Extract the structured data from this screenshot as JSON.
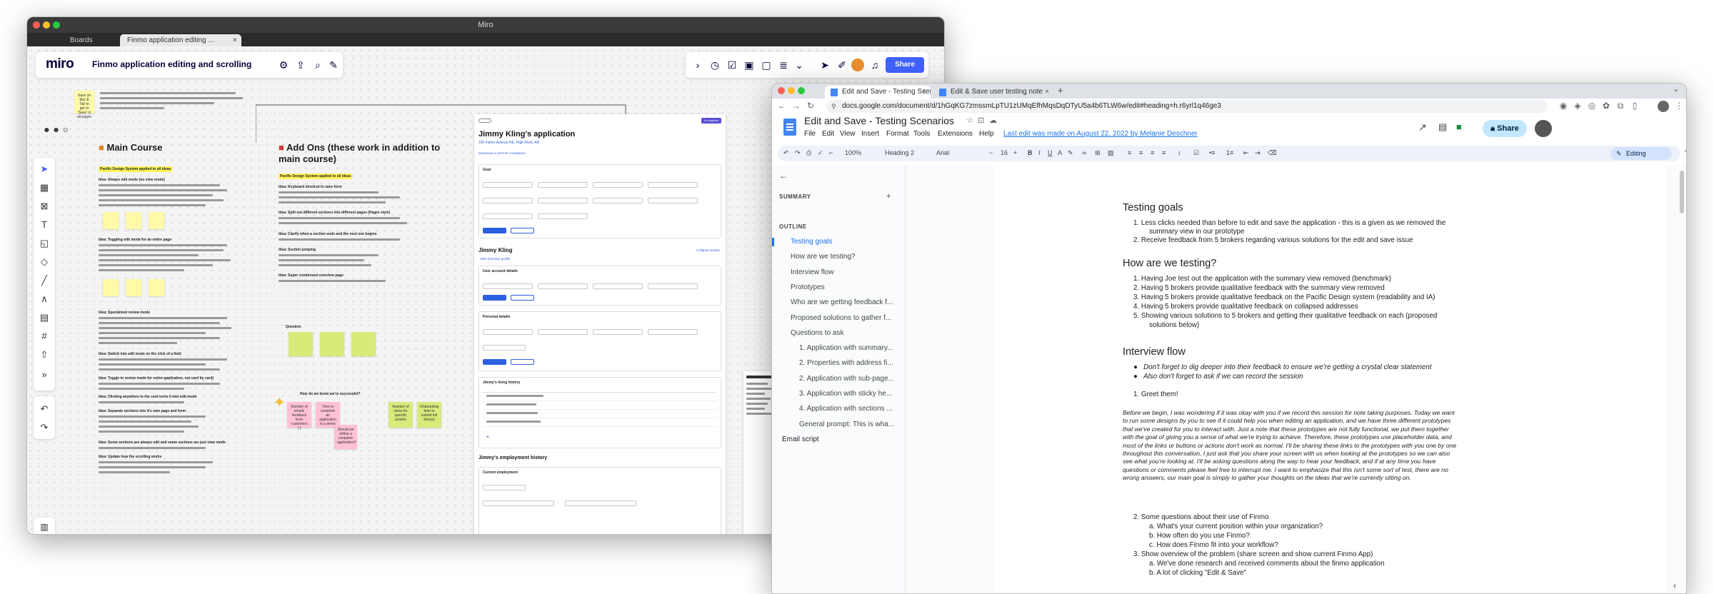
{
  "miro": {
    "window_title": "Miro",
    "tabs": [
      "Boards",
      "Finmo application editing ..."
    ],
    "board_name": "Finmo application editing and scrolling",
    "share_label": "Share",
    "columns": {
      "main_course": "Main Course",
      "add_ons": "Add Ons (these work in addition to main course)"
    },
    "highlights": {
      "left": "Pacific Design System applied to all ideas",
      "right": "Pacific Design System applied to all ideas"
    },
    "top_note": "Save on blur & Tab to get to 'Save' in all pages",
    "idea_labels": [
      "Idea: Always edit mode (no view mode)",
      "Idea: Toggling edit mode for an entire page",
      "Idea: Specialized review mode",
      "Idea: Switch into edit mode on the click of a field",
      "Idea: Toggle to review mode for entire application, not card by card)",
      "Idea: Clicking anywhere in the card turns it into edit mode",
      "Idea: Separate sections into it's own page and form",
      "Idea: Some sections are always edit and some sections are just view mode",
      "Idea: Update how the scrolling works",
      "Idea: Keyboard shortcut to save form",
      "Idea: Split out different sections into different pages (Pages style)",
      "Idea: Clarify when a section ends and the next one begins",
      "Idea: Section jumping",
      "Idea: Super condensed overview page"
    ],
    "question_label": "Question",
    "success_label": "How do we know we're successful?",
    "pink_notes": [
      "Number of emails feedback from customers (-)",
      "Time to complete an application in a demo",
      "Should we define a complete application?"
    ],
    "green_notes": [
      "Number of clicks for specific actions",
      "Onboarding time to submit full time(s)"
    ]
  },
  "jimmy": {
    "title": "Jimmy Kling's application",
    "address": "230 Fisher Avenue NE, High River, AB",
    "download_link": "Download or print for compliance",
    "goal_label": "Goal",
    "applicant_name": "Jimmy Kling",
    "collapse_all": "Collapse section",
    "view_borrower": "View borrower profile",
    "user_account": "User account details",
    "personal": "Personal details",
    "living_history": "Jimmy's living history",
    "employment": "Jimmy's employment history",
    "current_employment": "Current employment",
    "save_label": "Save changes",
    "undo_label": "Undo changes",
    "status_badge": "In progress"
  },
  "chrome": {
    "tabs": [
      {
        "label": "Edit and Save - Testing Scenari",
        "active": true
      },
      {
        "label": "Edit & Save user testing note",
        "active": false
      }
    ],
    "url": "docs.google.com/document/d/1hGqKG7zmssmLpTU1zUMqEfhMqsDqDTyU5a4b6TLW6w/edit#heading=h.r6yrl1q46ge3"
  },
  "docs": {
    "title": "Edit and Save - Testing Scenarios",
    "menu": [
      "File",
      "Edit",
      "View",
      "Insert",
      "Format",
      "Tools",
      "Extensions",
      "Help"
    ],
    "last_edit": "Last edit was made on August 22, 2022 by Melanie Deschner",
    "share_label": "Share",
    "toolbar": {
      "zoom": "100%",
      "style": "Heading 2",
      "font": "Arial",
      "size": "16",
      "editing": "Editing"
    },
    "summary_label": "SUMMARY",
    "outline_label": "OUTLINE",
    "outline": [
      {
        "label": "Testing goals",
        "active": true,
        "sub": false
      },
      {
        "label": "How are we testing?",
        "active": false,
        "sub": false
      },
      {
        "label": "Interview flow",
        "active": false,
        "sub": false
      },
      {
        "label": "Prototypes",
        "active": false,
        "sub": false
      },
      {
        "label": "Who are we getting feedback f...",
        "active": false,
        "sub": false
      },
      {
        "label": "Proposed solutions to gather f...",
        "active": false,
        "sub": false
      },
      {
        "label": "Questions to ask",
        "active": false,
        "sub": false
      },
      {
        "label": "1. Application with summary...",
        "active": false,
        "sub": true
      },
      {
        "label": "2. Properties with address fi...",
        "active": false,
        "sub": true
      },
      {
        "label": "2. Application with sub-page...",
        "active": false,
        "sub": true
      },
      {
        "label": "3. Application with sticky he...",
        "active": false,
        "sub": true
      },
      {
        "label": "4. Application with sections ...",
        "active": false,
        "sub": true
      },
      {
        "label": "General prompt: This is wha...",
        "active": false,
        "sub": true
      },
      {
        "label": "Email script",
        "active": false,
        "sub": false
      }
    ],
    "h_goals": "Testing goals",
    "goals": [
      "1.   Less clicks needed than before to edit and save the application - this is a given as we removed the",
      "summary view in our prototype",
      "2.   Receive feedback from 5 brokers regarding various solutions for the edit and save issue"
    ],
    "h_how": "How are we testing?",
    "how": [
      "1.   Having Joe test out the application with the summary view removed (benchmark)",
      "2.   Having 5 brokers provide qualitative feedback with the summary view removed",
      "3.   Having 5 brokers provide qualitative feedback on the Pacific Design system (readability and IA)",
      "4.   Having 5 brokers provide qualitative feedback on collapsed addresses",
      "5.   Showing various solutions to 5 brokers and getting their qualitative feedback on each (proposed",
      "solutions below)"
    ],
    "h_flow": "Interview flow",
    "flow_bullets": [
      "Don't forget to dig deeper into their feedback to ensure we're getting a crystal clear statement",
      "Also don't forget to ask if we can record the session"
    ],
    "greet": "1.   Greet them!",
    "para": "Before we begin, I was wondering if it was okay with you if we record this session for note taking purposes. Today we want to run some designs by you to see if it could help you when editing an application, and we have three different prototypes that we've created for you to interact with. Just a note that these prototypes are not fully functional, we put them together with the goal of giving you a sense of what we're trying to achieve. Therefore, these prototypes use placeholder data, and most of the links or buttons or actions don't work as normal. I'll be sharing these links to the prototypes with you one by one throughout this conversation, I just ask that you share your screen with us when looking at the prototypes so we can also see what you're looking at. I'll be asking questions along the way to hear your feedback, and if at any time you have questions or comments please feel free to interrupt me. I want to emphasize that this isn't some sort of test, there are no wrong answers, our main goal is simply to gather your thoughts on the ideas that we're currently sitting on.",
    "q2": "2.   Some questions about their use of Finmo",
    "q2a": "a.   What's your current position within your organization?",
    "q2b": "b.   How often do you use Finmo?",
    "q2c": "c.   How does Finmo fit into your workflow?",
    "q3": "3.   Show overview of the problem (share screen and show current Finmo App)",
    "q3a": "a.   We've done research and received comments about the finmo application",
    "q3b": "b.   A lot of clicking \"Edit & Save\""
  },
  "colors": {
    "miro_accent": "#4262ff",
    "docs_blue": "#1a73e8",
    "sticky_yellow": "#fff9a8",
    "sticky_green": "#d6eb7a",
    "sticky_pink": "#ffc1d7"
  }
}
